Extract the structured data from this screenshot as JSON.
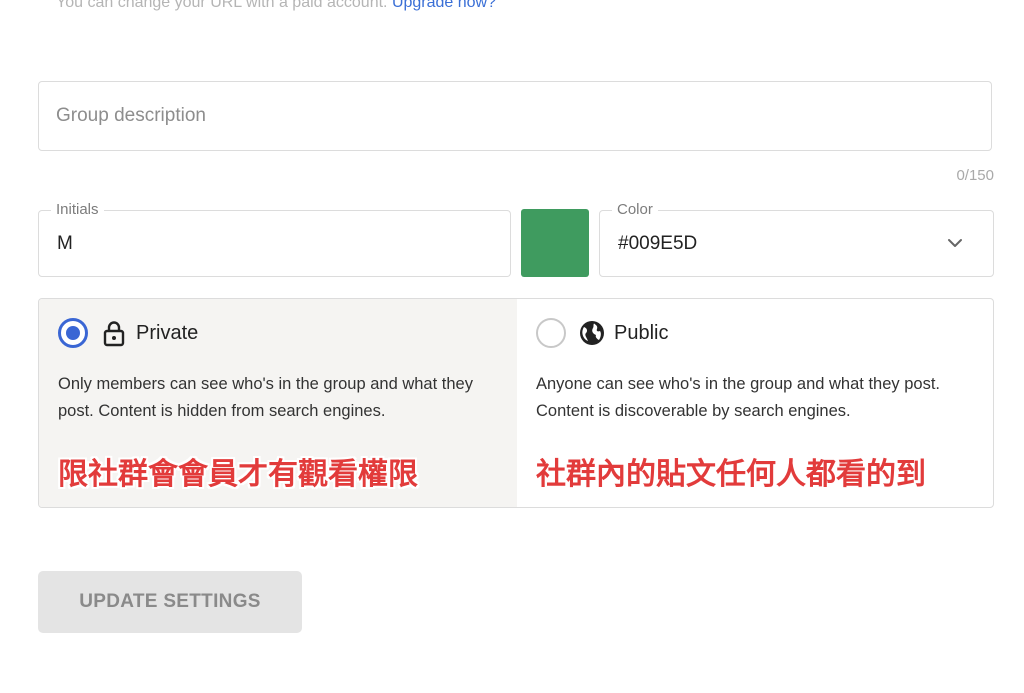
{
  "url_note": {
    "text": "You can change your URL with a paid account.",
    "link": "Upgrade now?"
  },
  "description": {
    "placeholder": "Group description",
    "counter": "0/150"
  },
  "initials": {
    "label": "Initials",
    "value": "M"
  },
  "color": {
    "label": "Color",
    "value": "#009E5D",
    "swatch": "#3f9b5f",
    "icon": "chevron-down-icon"
  },
  "privacy": {
    "private": {
      "title": "Private",
      "icon": "lock-icon",
      "selected": true,
      "description": "Only members can see who's in the group and what they post. Content is hidden from search engines.",
      "annotation": "限社群會會員才有觀看權限"
    },
    "public": {
      "title": "Public",
      "icon": "globe-icon",
      "selected": false,
      "description": "Anyone can see who's in the group and what they post. Content is discoverable by search engines.",
      "annotation": "社群內的貼文任何人都看的到"
    }
  },
  "actions": {
    "update_label": "UPDATE SETTINGS"
  }
}
